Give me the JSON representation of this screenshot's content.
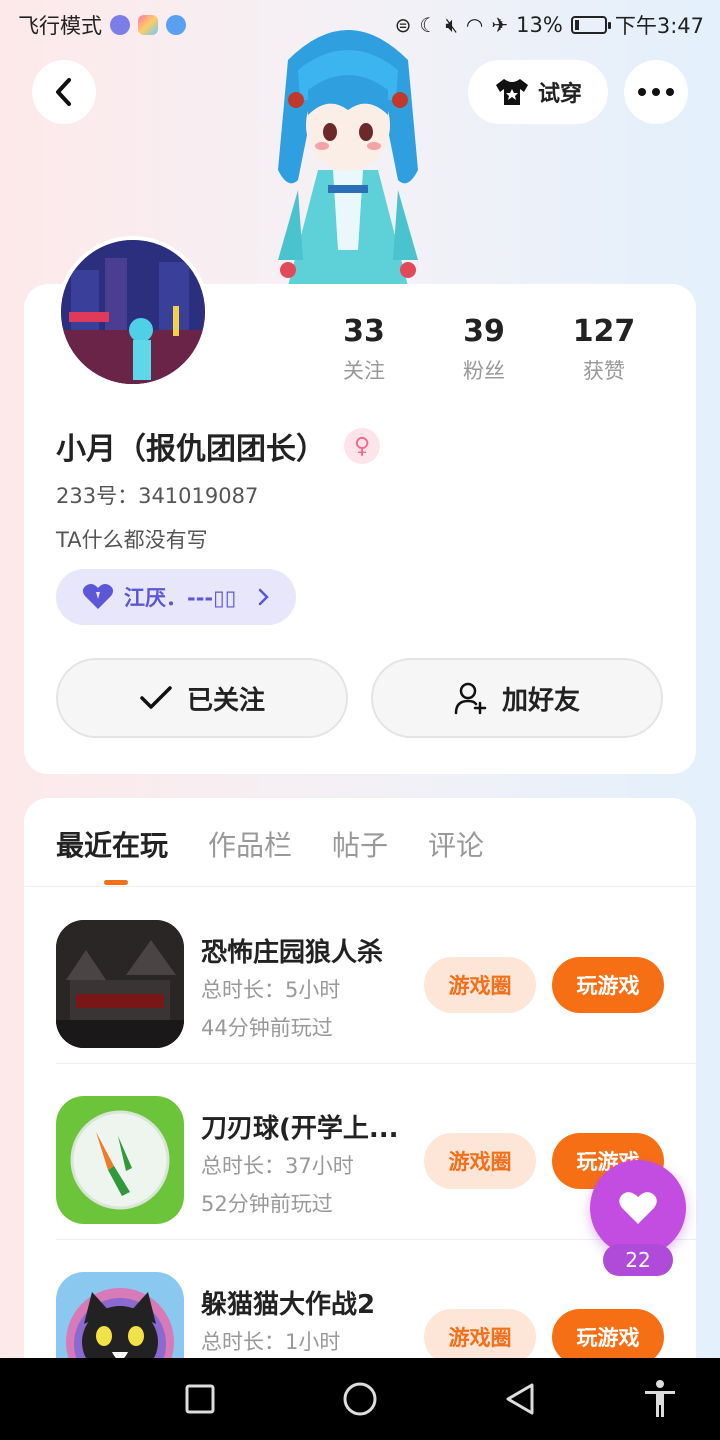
{
  "status_bar": {
    "mode_label": "飞行模式",
    "battery_percent": "13%",
    "battery_level": 0.13,
    "time": "下午3:47"
  },
  "header": {
    "try_on_label": "试穿"
  },
  "profile": {
    "stats": [
      {
        "value": "33",
        "label": "关注"
      },
      {
        "value": "39",
        "label": "粉丝"
      },
      {
        "value": "127",
        "label": "获赞"
      }
    ],
    "name": "小月（报仇团团长）",
    "uid": "233号：341019087",
    "bio": "TA什么都没有写",
    "guild_label": "江厌．---▯▯",
    "followed_label": "已关注",
    "add_friend_label": "加好友"
  },
  "tabs": [
    {
      "label": "最近在玩",
      "active": true
    },
    {
      "label": "作品栏",
      "active": false
    },
    {
      "label": "帖子",
      "active": false
    },
    {
      "label": "评论",
      "active": false
    }
  ],
  "games": [
    {
      "name": "恐怖庄园狼人杀",
      "time": "总时长：5小时",
      "last": "44分钟前玩过",
      "circle_label": "游戏圈",
      "play_label": "玩游戏"
    },
    {
      "name": "刀刃球(开学上...",
      "time": "总时长：37小时",
      "last": "52分钟前玩过",
      "circle_label": "游戏圈",
      "play_label": "玩游戏"
    },
    {
      "name": "躲猫猫大作战2",
      "time": "总时长：1小时",
      "last": "",
      "circle_label": "游戏圈",
      "play_label": "玩游戏"
    }
  ],
  "like": {
    "count": "22"
  },
  "colors": {
    "accent_orange": "#f66f14",
    "like_purple": "#c24de0",
    "guild_purple": "#5b57d6"
  }
}
